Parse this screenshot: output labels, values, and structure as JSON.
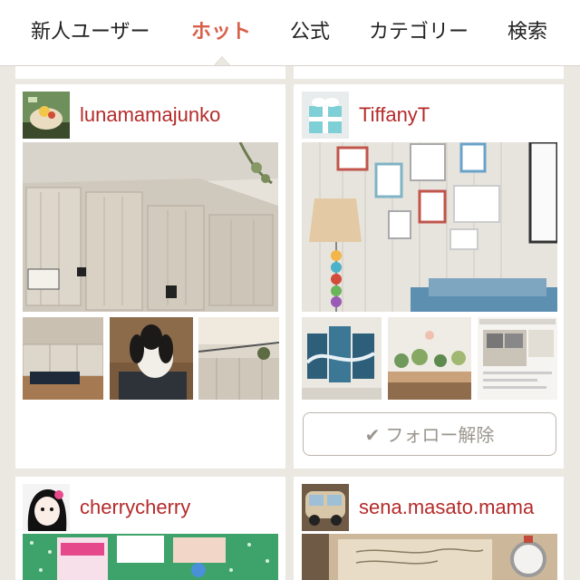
{
  "tabs": [
    {
      "label": "新人ユーザー"
    },
    {
      "label": "ホット"
    },
    {
      "label": "公式"
    },
    {
      "label": "カテゴリー"
    },
    {
      "label": "検索"
    }
  ],
  "active_tab": "ホット",
  "cards": [
    {
      "username": "lunamamajunko"
    },
    {
      "username": "TiffanyT",
      "follow_button": {
        "icon": "check-icon",
        "label": "フォロー解除"
      }
    },
    {
      "username": "cherrycherry"
    },
    {
      "username": "sena.masato.mama"
    }
  ],
  "colors": {
    "accent": "#d9604a",
    "username": "#b52a2a",
    "background": "#ebe8e2"
  }
}
